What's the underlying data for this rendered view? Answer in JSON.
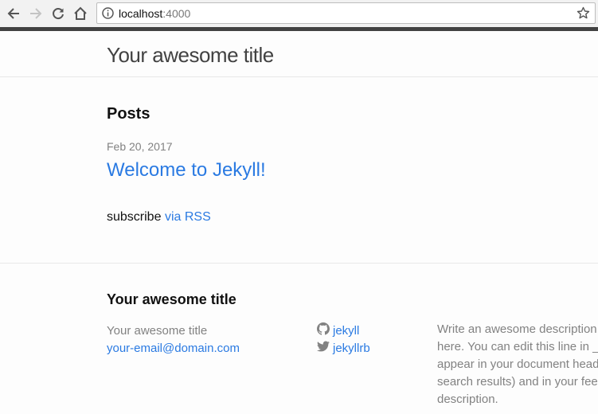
{
  "browser": {
    "url_host": "localhost",
    "url_port": ":4000",
    "icons": [
      "back-arrow-icon",
      "forward-arrow-icon",
      "reload-icon",
      "home-icon",
      "info-icon",
      "star-icon"
    ]
  },
  "header": {
    "site_title": "Your awesome title"
  },
  "main": {
    "posts_heading": "Posts",
    "posts": [
      {
        "date": "Feb 20, 2017",
        "title": "Welcome to Jekyll!"
      }
    ],
    "subscribe_text": "subscribe",
    "rss_link": "via RSS"
  },
  "footer": {
    "heading": "Your awesome title",
    "name": "Your awesome title",
    "email": "your-email@domain.com",
    "social": [
      {
        "icon": "github-icon",
        "label": "jekyll"
      },
      {
        "icon": "twitter-icon",
        "label": "jekyllrb"
      }
    ],
    "description_lines": [
      "Write an awesome description f",
      "here. You can edit this line in _c",
      "appear in your document head",
      "search results) and in your feed",
      "description."
    ]
  },
  "colors": {
    "link": "#2a7ae2",
    "text": "#111111",
    "muted": "#828282",
    "progress_strip": "#424242"
  }
}
